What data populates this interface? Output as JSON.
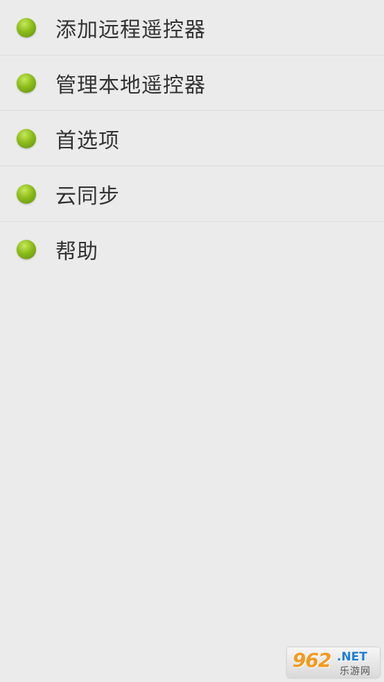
{
  "menu": {
    "items": [
      {
        "label": "添加远程遥控器"
      },
      {
        "label": "管理本地遥控器"
      },
      {
        "label": "首选项"
      },
      {
        "label": "云同步"
      },
      {
        "label": "帮助"
      }
    ]
  },
  "watermark": {
    "number": "962",
    "domain": ".NET",
    "chinese": "乐游网"
  },
  "colors": {
    "background": "#ebebeb",
    "bullet": "#8cbc1a",
    "text": "#333333",
    "divider": "#dcdcdc"
  }
}
